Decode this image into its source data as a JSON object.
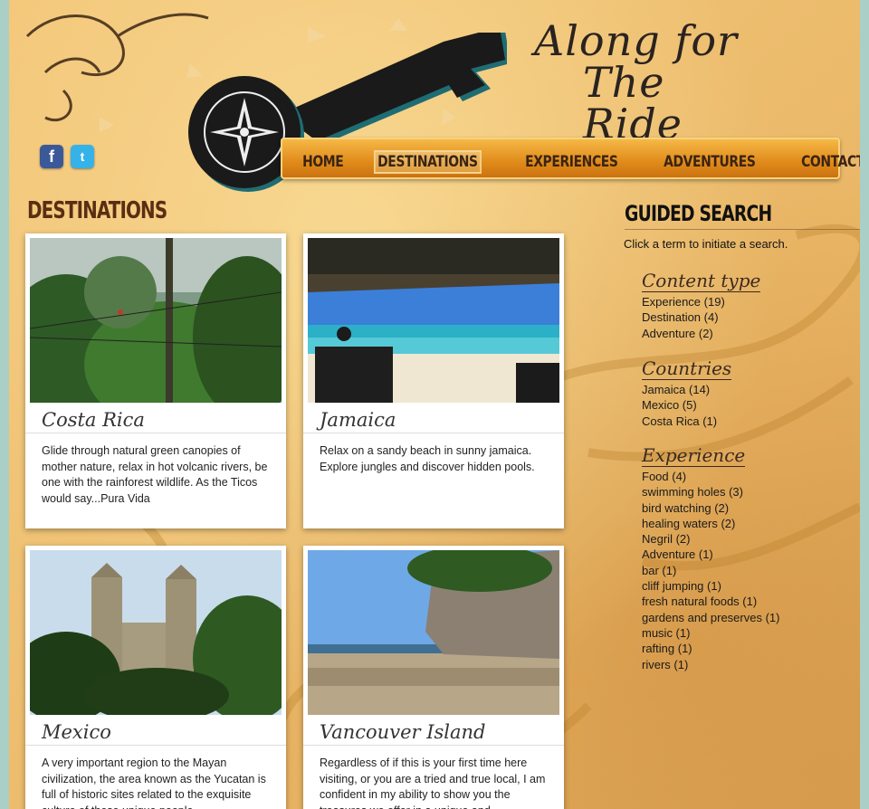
{
  "site": {
    "logo_line1": "Along for",
    "logo_line2": "The Ride"
  },
  "social": [
    {
      "icon": "facebook-icon",
      "glyph": "f"
    },
    {
      "icon": "twitter-icon",
      "glyph": "t"
    }
  ],
  "nav": [
    "HOME",
    "DESTINATIONS",
    "EXPERIENCES",
    "ADVENTURES",
    "CONTACT"
  ],
  "nav_active": "DESTINATIONS",
  "main": {
    "title": "DESTINATIONS",
    "cards": [
      {
        "title": "Costa Rica",
        "desc": "Glide through natural green canopies of mother nature, relax in hot volcanic rivers, be one with the rainforest wildlife. As the Ticos would say...Pura Vida"
      },
      {
        "title": "Jamaica",
        "desc": "Relax on a sandy beach in sunny jamaica. Explore jungles and discover hidden pools."
      },
      {
        "title": "Mexico",
        "desc": "A very important region to the Mayan civilization, the area known as the Yucatan is full of historic sites related to the exquisite culture of these unique people"
      },
      {
        "title": "Vancouver Island",
        "desc": "Regardless of if this is your first time here visiting, or you are a tried and true local, I am confident in my ability to show you the treasures we offer in a unique and"
      }
    ]
  },
  "sidebar": {
    "title": "GUIDED SEARCH",
    "hint": "Click a term to initiate a search.",
    "facets": [
      {
        "title": "Content type",
        "terms": [
          "Experience (19)",
          "Destination (4)",
          "Adventure (2)"
        ]
      },
      {
        "title": "Countries",
        "terms": [
          "Jamaica (14)",
          "Mexico (5)",
          "Costa Rica (1)"
        ]
      },
      {
        "title": "Experience",
        "terms": [
          "Food (4)",
          "swimming holes (3)",
          "bird watching (2)",
          "healing waters (2)",
          "Negril (2)",
          "Adventure (1)",
          "bar (1)",
          "cliff jumping (1)",
          "fresh natural foods (1)",
          "gardens and preserves (1)",
          "music (1)",
          "rafting (1)",
          "rivers (1)"
        ]
      }
    ]
  },
  "colors": {
    "parchment": "#efc173",
    "nav": "#e08a1a",
    "heading": "#5a2e12",
    "background": "#a9cfc6"
  }
}
